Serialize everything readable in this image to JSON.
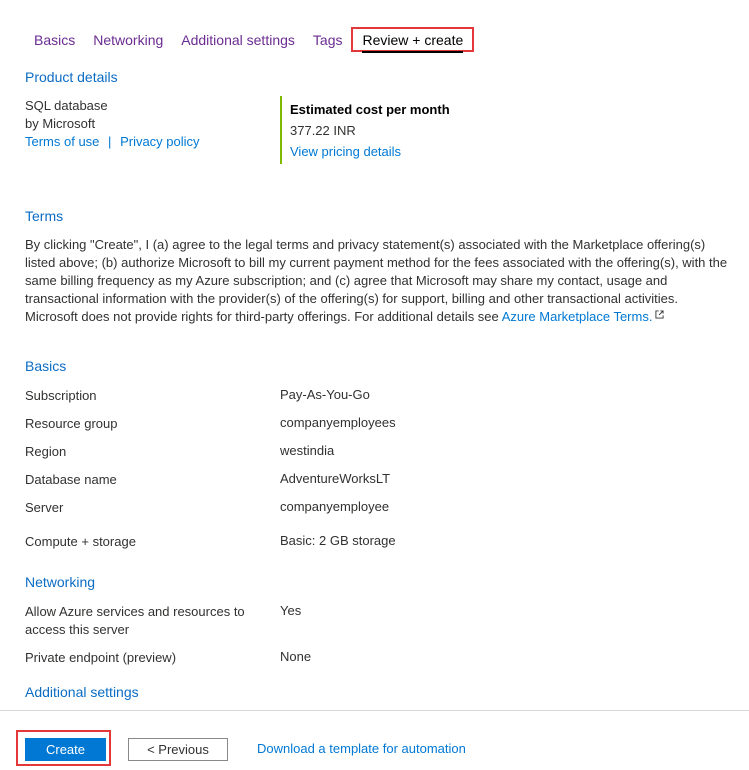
{
  "tabs": [
    {
      "label": "Basics"
    },
    {
      "label": "Networking"
    },
    {
      "label": "Additional settings"
    },
    {
      "label": "Tags"
    },
    {
      "label": "Review + create"
    }
  ],
  "product": {
    "heading": "Product details",
    "name": "SQL database",
    "publisher": "by Microsoft",
    "terms_link": "Terms of use",
    "separator": "|",
    "privacy_link": "Privacy policy",
    "cost_title": "Estimated cost per month",
    "cost_value": "377.22 INR",
    "pricing_link": "View pricing details"
  },
  "terms": {
    "heading": "Terms",
    "text": "By clicking \"Create\", I (a) agree to the legal terms and privacy statement(s) associated with the Marketplace offering(s) listed above; (b) authorize Microsoft to bill my current payment method for the fees associated with the offering(s), with the same billing frequency as my Azure subscription; and (c) agree that Microsoft may share my contact, usage and transactional information with the provider(s) of the offering(s) for support, billing and other transactional activities. Microsoft does not provide rights for third-party offerings. For additional details see",
    "link": "Azure Marketplace Terms."
  },
  "basics": {
    "heading": "Basics",
    "rows": [
      {
        "key": "Subscription",
        "value": "Pay-As-You-Go"
      },
      {
        "key": "Resource group",
        "value": "companyemployees"
      },
      {
        "key": "Region",
        "value": "westindia"
      },
      {
        "key": "Database name",
        "value": "AdventureWorksLT"
      },
      {
        "key": "Server",
        "value": "companyemployee"
      },
      {
        "key": "Compute + storage",
        "value": "Basic: 2 GB storage"
      }
    ]
  },
  "networking": {
    "heading": "Networking",
    "rows": [
      {
        "key": "Allow Azure services and resources to access this server",
        "value": "Yes"
      },
      {
        "key": "Private endpoint (preview)",
        "value": "None"
      }
    ]
  },
  "additional": {
    "heading": "Additional settings"
  },
  "footer": {
    "create": "Create",
    "previous": "< Previous",
    "download": "Download a template for automation"
  },
  "colors": {
    "accent": "#0078d4",
    "heading": "#0b6cc4",
    "tab": "#6b2c91",
    "highlight": "#e3373a",
    "cost_border": "#7fba00"
  },
  "icons": {
    "external_link": "external-link-icon"
  }
}
